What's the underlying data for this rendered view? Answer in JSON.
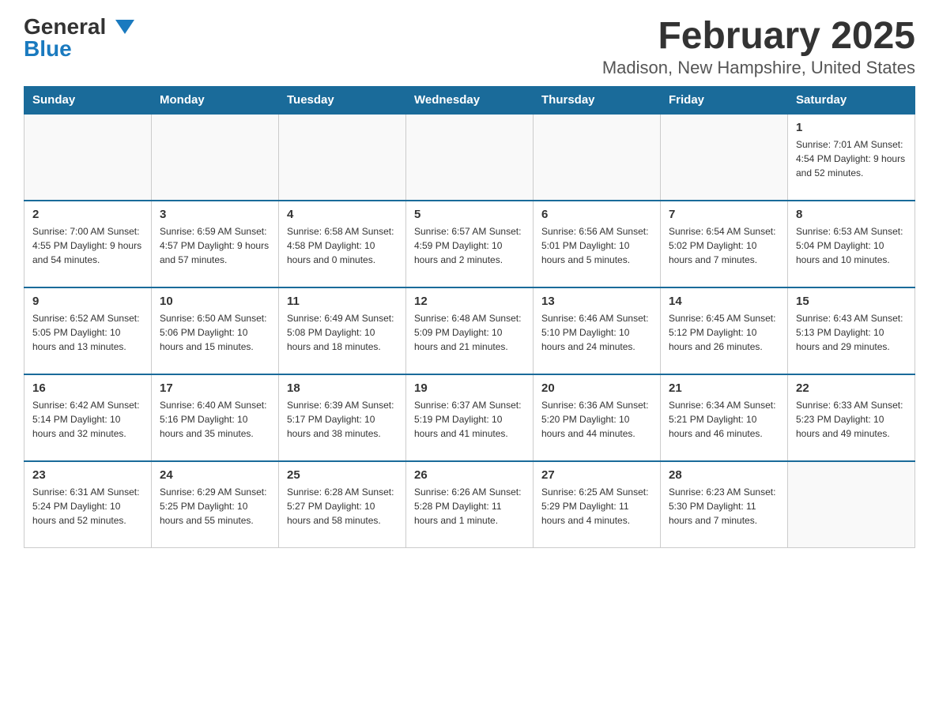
{
  "logo": {
    "general": "General",
    "blue": "Blue"
  },
  "header": {
    "month_title": "February 2025",
    "location": "Madison, New Hampshire, United States"
  },
  "weekdays": [
    "Sunday",
    "Monday",
    "Tuesday",
    "Wednesday",
    "Thursday",
    "Friday",
    "Saturday"
  ],
  "weeks": [
    [
      {
        "day": "",
        "info": ""
      },
      {
        "day": "",
        "info": ""
      },
      {
        "day": "",
        "info": ""
      },
      {
        "day": "",
        "info": ""
      },
      {
        "day": "",
        "info": ""
      },
      {
        "day": "",
        "info": ""
      },
      {
        "day": "1",
        "info": "Sunrise: 7:01 AM\nSunset: 4:54 PM\nDaylight: 9 hours\nand 52 minutes."
      }
    ],
    [
      {
        "day": "2",
        "info": "Sunrise: 7:00 AM\nSunset: 4:55 PM\nDaylight: 9 hours\nand 54 minutes."
      },
      {
        "day": "3",
        "info": "Sunrise: 6:59 AM\nSunset: 4:57 PM\nDaylight: 9 hours\nand 57 minutes."
      },
      {
        "day": "4",
        "info": "Sunrise: 6:58 AM\nSunset: 4:58 PM\nDaylight: 10 hours\nand 0 minutes."
      },
      {
        "day": "5",
        "info": "Sunrise: 6:57 AM\nSunset: 4:59 PM\nDaylight: 10 hours\nand 2 minutes."
      },
      {
        "day": "6",
        "info": "Sunrise: 6:56 AM\nSunset: 5:01 PM\nDaylight: 10 hours\nand 5 minutes."
      },
      {
        "day": "7",
        "info": "Sunrise: 6:54 AM\nSunset: 5:02 PM\nDaylight: 10 hours\nand 7 minutes."
      },
      {
        "day": "8",
        "info": "Sunrise: 6:53 AM\nSunset: 5:04 PM\nDaylight: 10 hours\nand 10 minutes."
      }
    ],
    [
      {
        "day": "9",
        "info": "Sunrise: 6:52 AM\nSunset: 5:05 PM\nDaylight: 10 hours\nand 13 minutes."
      },
      {
        "day": "10",
        "info": "Sunrise: 6:50 AM\nSunset: 5:06 PM\nDaylight: 10 hours\nand 15 minutes."
      },
      {
        "day": "11",
        "info": "Sunrise: 6:49 AM\nSunset: 5:08 PM\nDaylight: 10 hours\nand 18 minutes."
      },
      {
        "day": "12",
        "info": "Sunrise: 6:48 AM\nSunset: 5:09 PM\nDaylight: 10 hours\nand 21 minutes."
      },
      {
        "day": "13",
        "info": "Sunrise: 6:46 AM\nSunset: 5:10 PM\nDaylight: 10 hours\nand 24 minutes."
      },
      {
        "day": "14",
        "info": "Sunrise: 6:45 AM\nSunset: 5:12 PM\nDaylight: 10 hours\nand 26 minutes."
      },
      {
        "day": "15",
        "info": "Sunrise: 6:43 AM\nSunset: 5:13 PM\nDaylight: 10 hours\nand 29 minutes."
      }
    ],
    [
      {
        "day": "16",
        "info": "Sunrise: 6:42 AM\nSunset: 5:14 PM\nDaylight: 10 hours\nand 32 minutes."
      },
      {
        "day": "17",
        "info": "Sunrise: 6:40 AM\nSunset: 5:16 PM\nDaylight: 10 hours\nand 35 minutes."
      },
      {
        "day": "18",
        "info": "Sunrise: 6:39 AM\nSunset: 5:17 PM\nDaylight: 10 hours\nand 38 minutes."
      },
      {
        "day": "19",
        "info": "Sunrise: 6:37 AM\nSunset: 5:19 PM\nDaylight: 10 hours\nand 41 minutes."
      },
      {
        "day": "20",
        "info": "Sunrise: 6:36 AM\nSunset: 5:20 PM\nDaylight: 10 hours\nand 44 minutes."
      },
      {
        "day": "21",
        "info": "Sunrise: 6:34 AM\nSunset: 5:21 PM\nDaylight: 10 hours\nand 46 minutes."
      },
      {
        "day": "22",
        "info": "Sunrise: 6:33 AM\nSunset: 5:23 PM\nDaylight: 10 hours\nand 49 minutes."
      }
    ],
    [
      {
        "day": "23",
        "info": "Sunrise: 6:31 AM\nSunset: 5:24 PM\nDaylight: 10 hours\nand 52 minutes."
      },
      {
        "day": "24",
        "info": "Sunrise: 6:29 AM\nSunset: 5:25 PM\nDaylight: 10 hours\nand 55 minutes."
      },
      {
        "day": "25",
        "info": "Sunrise: 6:28 AM\nSunset: 5:27 PM\nDaylight: 10 hours\nand 58 minutes."
      },
      {
        "day": "26",
        "info": "Sunrise: 6:26 AM\nSunset: 5:28 PM\nDaylight: 11 hours\nand 1 minute."
      },
      {
        "day": "27",
        "info": "Sunrise: 6:25 AM\nSunset: 5:29 PM\nDaylight: 11 hours\nand 4 minutes."
      },
      {
        "day": "28",
        "info": "Sunrise: 6:23 AM\nSunset: 5:30 PM\nDaylight: 11 hours\nand 7 minutes."
      },
      {
        "day": "",
        "info": ""
      }
    ]
  ]
}
